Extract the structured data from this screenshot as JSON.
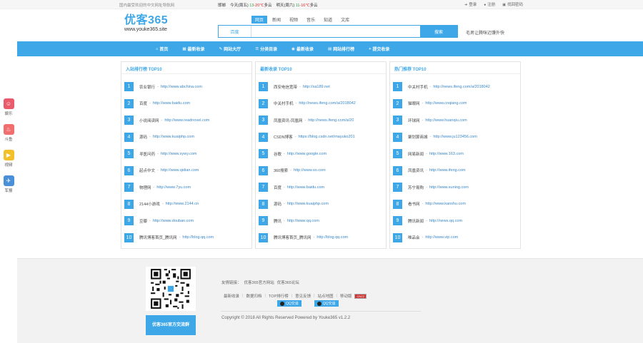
{
  "topbar": {
    "slogan": "国内最受欢迎的中文网址导航网",
    "weather_city": "邯郸",
    "today_label": "今天(周五)",
    "today_temp": "13",
    "today_temp2": "-20℃",
    "today_weather": "多云",
    "tomorrow_label": "明天(周六)",
    "tomorrow_temp": "11",
    "tomorrow_temp2": "-16℃",
    "tomorrow_weather": "多云",
    "login": "登录",
    "register": "注册",
    "forgot": "找回密码"
  },
  "header": {
    "brand": "优客365",
    "site": "www.youke365.site",
    "search_tabs": [
      "网页",
      "新闻",
      "视频",
      "音乐",
      "知道",
      "文库"
    ],
    "engine": "百度",
    "search_button": "搜索",
    "search_placeholder": "",
    "hot_word": "毛男让腾咪迈馕外快"
  },
  "nav": {
    "items": [
      {
        "icon": "⌂",
        "label": "首页"
      },
      {
        "icon": "▦",
        "label": "最新收录"
      },
      {
        "icon": "✎",
        "label": "网站大厅"
      },
      {
        "icon": "☰",
        "label": "分类目录"
      },
      {
        "icon": "◉",
        "label": "最新收录"
      },
      {
        "icon": "▤",
        "label": "网站排行榜"
      },
      {
        "icon": "+",
        "label": "提交收录"
      }
    ]
  },
  "sidebar": [
    {
      "label": "娱乐",
      "color": "#e95a6b",
      "icon": "☺"
    },
    {
      "label": "斗鱼",
      "color": "#f06e6e",
      "icon": "♨"
    },
    {
      "label": "视频",
      "color": "#f4c02a",
      "icon": "▶"
    },
    {
      "label": "军报",
      "color": "#4a90d9",
      "icon": "✈"
    }
  ],
  "panels": [
    {
      "title": "入站排行榜 TOP10",
      "rows": [
        {
          "n": "1",
          "name": "农业银行",
          "url": "http://www.abchina.com"
        },
        {
          "n": "2",
          "name": "百度",
          "url": "http://www.baidu.com"
        },
        {
          "n": "3",
          "name": "小说阅读网",
          "url": "http://www.readnovel.com"
        },
        {
          "n": "4",
          "name": "源码",
          "url": "http://www.kuaiphp.com"
        },
        {
          "n": "5",
          "name": "寻医问药",
          "url": "http://www.xywy.com"
        },
        {
          "n": "6",
          "name": "起点中文",
          "url": "http://www.qidian.com"
        },
        {
          "n": "7",
          "name": "物理网",
          "url": "http://www.7yu.com"
        },
        {
          "n": "8",
          "name": "2144小游戏",
          "url": "http://www.2144.cn"
        },
        {
          "n": "9",
          "name": "豆瓣",
          "url": "http://www.douban.com"
        },
        {
          "n": "10",
          "name": "腾讯博客首页_腾讯网",
          "url": "http://blog.qq.com"
        }
      ]
    },
    {
      "title": "最新收录 TOP10",
      "rows": [
        {
          "n": "1",
          "name": "西安电信宽带",
          "url": "http://xa189.net"
        },
        {
          "n": "2",
          "name": "中关村手机",
          "url": "http://news.ifeng.com/a/2018042"
        },
        {
          "n": "3",
          "name": "凤凰资讯-凤凰网",
          "url": "http://news.ifeng.com/a/20"
        },
        {
          "n": "4",
          "name": "CSDN博客",
          "url": "https://blog.csdn.net/mayuko201"
        },
        {
          "n": "5",
          "name": "谷歌",
          "url": "http://www.google.com"
        },
        {
          "n": "6",
          "name": "360搜索",
          "url": "http://www.so.com"
        },
        {
          "n": "7",
          "name": "百度",
          "url": "http://www.baidu.com"
        },
        {
          "n": "8",
          "name": "源码",
          "url": "http://www.kuaiphp.com"
        },
        {
          "n": "9",
          "name": "腾讯",
          "url": "http://www.qq.com"
        },
        {
          "n": "10",
          "name": "腾讯博客首页_腾讯网",
          "url": "http://blog.qq.com"
        }
      ]
    },
    {
      "title": "热门推荐 TOP10",
      "rows": [
        {
          "n": "1",
          "name": "中关村手机",
          "url": "http://news.ifeng.com/a/2018042"
        },
        {
          "n": "2",
          "name": "猫眼网",
          "url": "http://www.cnqiang.com"
        },
        {
          "n": "3",
          "name": "环球网",
          "url": "http://www.huanqiu.com"
        },
        {
          "n": "4",
          "name": "聚划算商城",
          "url": "http://www.ju123456.com"
        },
        {
          "n": "5",
          "name": "网易新闻",
          "url": "http://www.163.com"
        },
        {
          "n": "6",
          "name": "凤凰资讯",
          "url": "http://www.ifeng.com"
        },
        {
          "n": "7",
          "name": "苏宁易购",
          "url": "http://www.suning.com"
        },
        {
          "n": "8",
          "name": "看书网",
          "url": "http://www.kanshu.com"
        },
        {
          "n": "9",
          "name": "腾讯新闻",
          "url": "http://news.qq.com"
        },
        {
          "n": "10",
          "name": "唯品会",
          "url": "http://www.vip.com"
        }
      ]
    }
  ],
  "footer": {
    "qq_group_button": "优客365官方交流群",
    "friend_label": "友情链接：",
    "friend_links": [
      "优客365官方网站",
      "优客365论坛"
    ],
    "links": [
      "最新收录",
      "数据归档",
      "TOP排行榜",
      "意见反馈",
      "站点地图",
      "移动版"
    ],
    "stat_badge": "CNZZ",
    "qq_buttons": [
      "QQ交谈",
      "QQ交谈"
    ],
    "copyright": "Copyright © 2018 All Rights Reserved Powered by Youke365 v1.2.2"
  }
}
